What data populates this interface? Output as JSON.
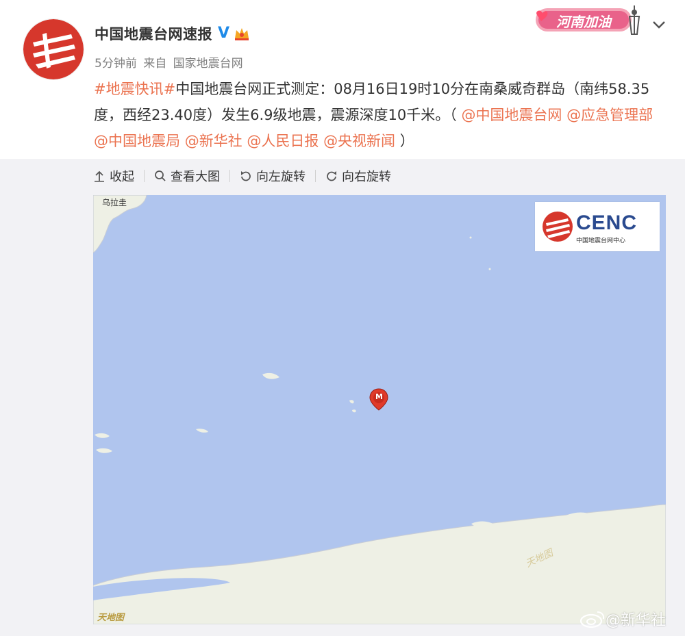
{
  "post": {
    "author": "中国地震台网速报",
    "time": "5分钟前",
    "source_prefix": "来自",
    "source": "国家地震台网",
    "badge_text": "河南加油",
    "text": {
      "hashtag": "#地震快讯#",
      "body": "中国地震台网正式测定：08月16日19时10分在南桑威奇群岛（南纬58.35度，西经23.40度）发生6.9级地震，震源深度10千米。（",
      "mention1": "@中国地震台网",
      "mention2": "@应急管理部",
      "mention3": "@中国地震局",
      "mention4": "@新华社",
      "mention5": "@人民日报",
      "mention6": "@央视新闻",
      "close": "）"
    }
  },
  "toolbar": {
    "collapse": "收起",
    "view_large": "查看大图",
    "rotate_left": "向左旋转",
    "rotate_right": "向右旋转"
  },
  "map": {
    "place_label": "乌拉圭",
    "logo_title": "CENC",
    "logo_subtitle": "中国地震台网中心",
    "watermark": "天地图",
    "marker_label": "M",
    "colors": {
      "sea": "#b0c5ee",
      "land": "#eef0e5",
      "marker": "#e03a2a"
    }
  },
  "footer_watermark": "@新华社",
  "icons": [
    "verified-icon",
    "crown-icon",
    "chevron-down-icon",
    "collapse-icon",
    "search-icon",
    "rotate-left-icon",
    "rotate-right-icon",
    "map-marker-icon",
    "weibo-icon"
  ]
}
